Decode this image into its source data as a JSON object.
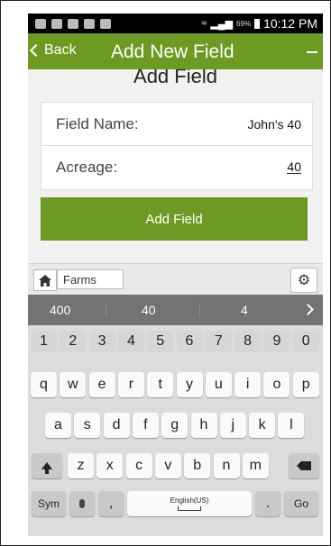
{
  "statusbar": {
    "battery_pct": "69%",
    "time": "10:12 PM"
  },
  "navbar": {
    "back_label": "Back",
    "title": "Add New Field"
  },
  "form": {
    "section_title": "Add Field",
    "field_name_label": "Field Name:",
    "field_name_value": "John's 40",
    "acreage_label": "Acreage:",
    "acreage_value": "40"
  },
  "add_button": {
    "label": "Add Field"
  },
  "keyboard": {
    "toolbar": {
      "farms_label": "Farms"
    },
    "suggestions": [
      "400",
      "40",
      "4"
    ],
    "number_row": [
      "1",
      "2",
      "3",
      "4",
      "5",
      "6",
      "7",
      "8",
      "9",
      "0"
    ],
    "row1": [
      "q",
      "w",
      "e",
      "r",
      "t",
      "y",
      "u",
      "i",
      "o",
      "p"
    ],
    "row2": [
      "a",
      "s",
      "d",
      "f",
      "g",
      "h",
      "j",
      "k",
      "l"
    ],
    "row3": [
      "z",
      "x",
      "c",
      "v",
      "b",
      "n",
      "m"
    ],
    "sym_label": "Sym",
    "comma": ",",
    "space_label": "English(US)",
    "period": ".",
    "go_label": "Go"
  },
  "icons": [
    "chevron-left-icon",
    "minus-icon",
    "home-icon",
    "gear-icon",
    "chevron-right-icon",
    "shift-icon",
    "backspace-icon",
    "mic-icon"
  ]
}
